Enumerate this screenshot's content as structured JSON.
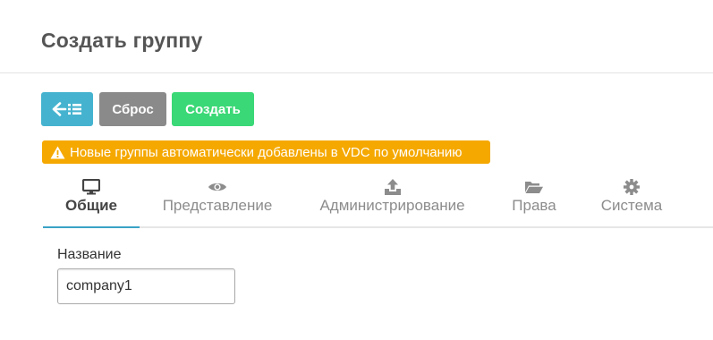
{
  "page": {
    "title": "Создать группу"
  },
  "toolbar": {
    "back_icon": "arrow-left-list-icon",
    "reset_label": "Сброс",
    "create_label": "Создать",
    "colors": {
      "back": "#45b3cf",
      "reset": "#8a8a8a",
      "create": "#3ad876"
    }
  },
  "notice": {
    "icon": "warning-icon",
    "text": "Новые группы автоматически добавлены в VDC по умолчанию",
    "color": "#f5a800"
  },
  "tabs": [
    {
      "icon": "desktop-icon",
      "label": "Общие",
      "active": true
    },
    {
      "icon": "eye-icon",
      "label": "Представление",
      "active": false
    },
    {
      "icon": "upload-icon",
      "label": "Администрирование",
      "active": false
    },
    {
      "icon": "folder-open-icon",
      "label": "Права",
      "active": false
    },
    {
      "icon": "gear-icon",
      "label": "Система",
      "active": false
    }
  ],
  "form": {
    "name_label": "Название",
    "name_value": "company1"
  },
  "accent_color": "#3aa3c6"
}
